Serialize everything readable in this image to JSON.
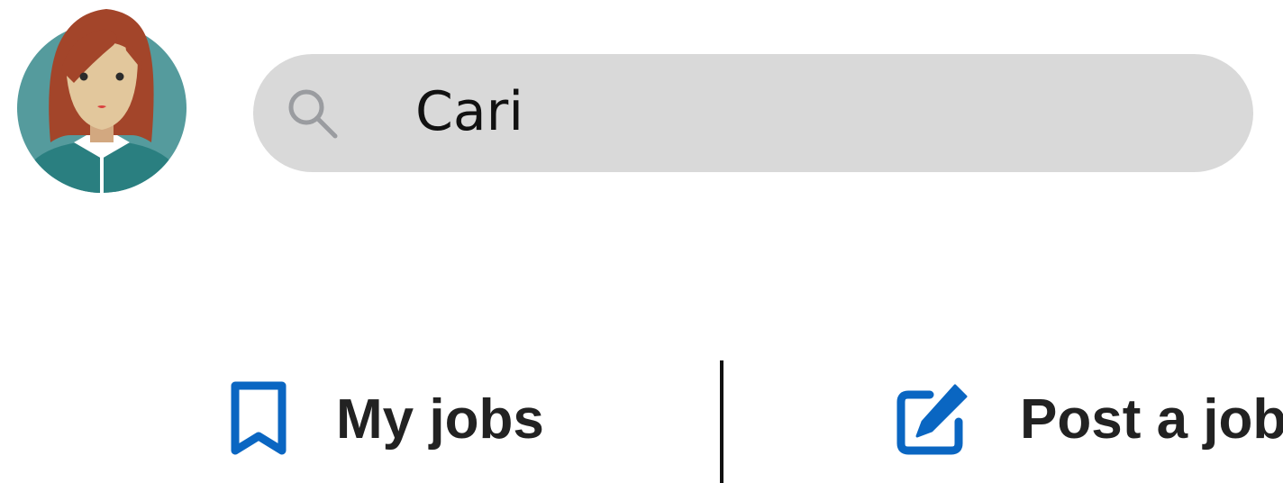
{
  "profile": {
    "avatar_icon": "user-avatar-icon"
  },
  "search": {
    "icon": "search-icon",
    "value": "Cari",
    "placeholder": "Cari"
  },
  "nav": {
    "my_jobs": {
      "label": "My jobs",
      "icon": "bookmark-icon"
    },
    "post_job": {
      "label": "Post a job",
      "icon": "edit-icon"
    }
  },
  "colors": {
    "accent": "#0a66c2",
    "search_bg": "#d9d9d9",
    "avatar_bg": "#4f9a9c",
    "text": "#222222"
  }
}
